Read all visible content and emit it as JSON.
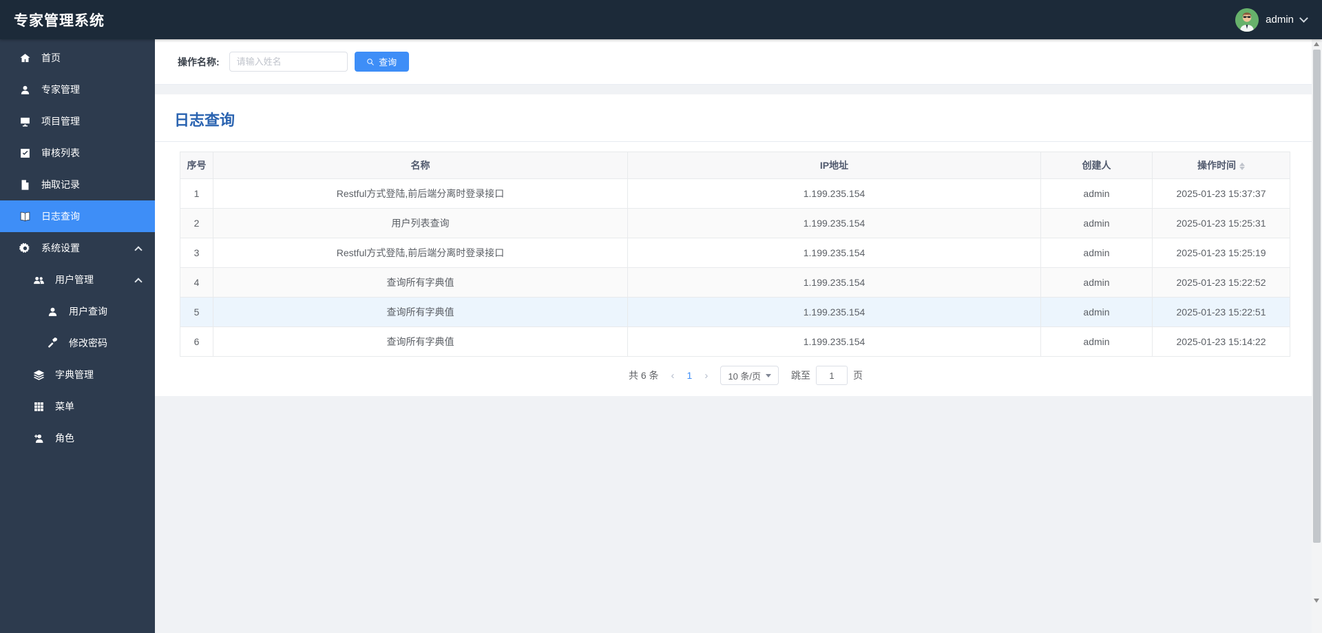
{
  "app": {
    "title": "专家管理系统"
  },
  "navbar": {
    "username": "admin",
    "avatar_icon": "green-cartoon-avatar"
  },
  "colors": {
    "navbar_bg": "#1c2a39",
    "sidebar_bg": "#2d3b4e",
    "active_menu_bg": "#3e8ef7",
    "primary_button": "#3e8ef7",
    "page_title": "#2a63b0",
    "page_bg": "#f0f2f5",
    "table_header_bg": "#f8f8f9",
    "hover_row_bg": "#ecf5fd"
  },
  "sidebar": {
    "items": [
      {
        "label": "首页",
        "icon": "home-icon",
        "level": 0,
        "active": false,
        "expanded": null
      },
      {
        "label": "专家管理",
        "icon": "user-icon",
        "level": 0,
        "active": false,
        "expanded": null
      },
      {
        "label": "项目管理",
        "icon": "monitor-icon",
        "level": 0,
        "active": false,
        "expanded": null
      },
      {
        "label": "审核列表",
        "icon": "check-square-icon",
        "level": 0,
        "active": false,
        "expanded": null
      },
      {
        "label": "抽取记录",
        "icon": "file-icon",
        "level": 0,
        "active": false,
        "expanded": null
      },
      {
        "label": "日志查询",
        "icon": "book-icon",
        "level": 0,
        "active": true,
        "expanded": null
      },
      {
        "label": "系统设置",
        "icon": "gear-icon",
        "level": 0,
        "active": false,
        "expanded": true
      },
      {
        "label": "用户管理",
        "icon": "users-icon",
        "level": 1,
        "active": false,
        "expanded": true
      },
      {
        "label": "用户查询",
        "icon": "user-icon",
        "level": 2,
        "active": false,
        "expanded": null
      },
      {
        "label": "修改密码",
        "icon": "hammer-icon",
        "level": 2,
        "active": false,
        "expanded": null
      },
      {
        "label": "字典管理",
        "icon": "layers-icon",
        "level": 1,
        "active": false,
        "expanded": null
      },
      {
        "label": "菜单",
        "icon": "grid-icon",
        "level": 1,
        "active": false,
        "expanded": null
      },
      {
        "label": "角色",
        "icon": "user-plus-icon",
        "level": 1,
        "active": false,
        "expanded": null
      }
    ]
  },
  "search": {
    "label": "操作名称:",
    "placeholder": "请输入姓名",
    "value": "",
    "button_label": "查询"
  },
  "page": {
    "title": "日志查询"
  },
  "table": {
    "columns": {
      "no": "序号",
      "name": "名称",
      "ip": "IP地址",
      "creator": "创建人",
      "time": "操作时间"
    },
    "sorted_column": "操作时间",
    "rows": [
      {
        "no": "1",
        "name": "Restful方式登陆,前后端分离时登录接口",
        "ip": "1.199.235.154",
        "creator": "admin",
        "time": "2025-01-23 15:37:37"
      },
      {
        "no": "2",
        "name": "用户列表查询",
        "ip": "1.199.235.154",
        "creator": "admin",
        "time": "2025-01-23 15:25:31"
      },
      {
        "no": "3",
        "name": "Restful方式登陆,前后端分离时登录接口",
        "ip": "1.199.235.154",
        "creator": "admin",
        "time": "2025-01-23 15:25:19"
      },
      {
        "no": "4",
        "name": "查询所有字典值",
        "ip": "1.199.235.154",
        "creator": "admin",
        "time": "2025-01-23 15:22:52"
      },
      {
        "no": "5",
        "name": "查询所有字典值",
        "ip": "1.199.235.154",
        "creator": "admin",
        "time": "2025-01-23 15:22:51"
      },
      {
        "no": "6",
        "name": "查询所有字典值",
        "ip": "1.199.235.154",
        "creator": "admin",
        "time": "2025-01-23 15:14:22"
      }
    ]
  },
  "pagination": {
    "total_text": "共 6 条",
    "prev": "‹",
    "current_page": "1",
    "next": "›",
    "page_size_text": "10 条/页",
    "jump_label": "跳至",
    "jump_value": "1",
    "jump_suffix": "页"
  }
}
